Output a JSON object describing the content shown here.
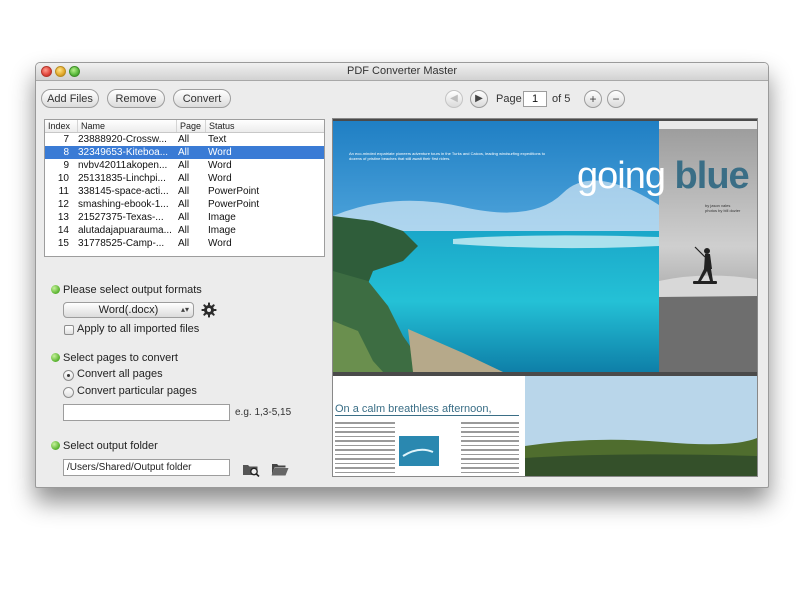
{
  "window": {
    "title": "PDF Converter Master"
  },
  "toolbar": {
    "add_files": "Add Files",
    "remove": "Remove",
    "convert": "Convert",
    "prev_icon": "◀",
    "next_icon": "▶",
    "page_label": "Page",
    "page_value": "1",
    "of_label": "of 5",
    "zoom_in": "+",
    "zoom_out": "−"
  },
  "table": {
    "headers": {
      "index": "Index",
      "name": "Name",
      "page": "Page",
      "status": "Status"
    },
    "rows": [
      {
        "index": "7",
        "name": "23888920-Crossw...",
        "page": "All",
        "status": "Text"
      },
      {
        "index": "8",
        "name": "32349653-Kiteboa...",
        "page": "All",
        "status": "Word"
      },
      {
        "index": "9",
        "name": "nvbv42011akopen...",
        "page": "All",
        "status": "Word"
      },
      {
        "index": "10",
        "name": "25131835-Linchpi...",
        "page": "All",
        "status": "Word"
      },
      {
        "index": "11",
        "name": "338145-space-acti...",
        "page": "All",
        "status": "PowerPoint"
      },
      {
        "index": "12",
        "name": "smashing-ebook-1...",
        "page": "All",
        "status": "PowerPoint"
      },
      {
        "index": "13",
        "name": "21527375-Texas-...",
        "page": "All",
        "status": "Image"
      },
      {
        "index": "14",
        "name": "alutadajapuarauma...",
        "page": "All",
        "status": "Image"
      },
      {
        "index": "15",
        "name": "31778525-Camp-...",
        "page": "All",
        "status": "Word"
      }
    ],
    "selected_index": 1
  },
  "formats": {
    "heading": "Please select output formats",
    "selected": "Word(.docx)",
    "apply_all": "Apply to all imported files"
  },
  "pages": {
    "heading": "Select pages to convert",
    "all": "Convert all pages",
    "particular": "Convert particular pages",
    "range_value": "",
    "hint": "e.g. 1,3-5,15"
  },
  "folder": {
    "heading": "Select output folder",
    "path": "/Users/Shared/Output folder"
  },
  "preview": {
    "title_part1": "going",
    "title_part2": "blue",
    "intro": "An eco-minded expatriate pioneers adventure tours in the Turks and Caicos, leading windsurfing expeditions to dozens of pristine beaches that still await their first riders.",
    "byline1": "by jason vales",
    "byline2": "photos by bill dozier",
    "page2_heading": "On a calm breathless afternoon,"
  },
  "colors": {
    "selection": "#3a7bd5",
    "accent_blue": "#3a6e86",
    "bullet_green": "#5cb531"
  }
}
